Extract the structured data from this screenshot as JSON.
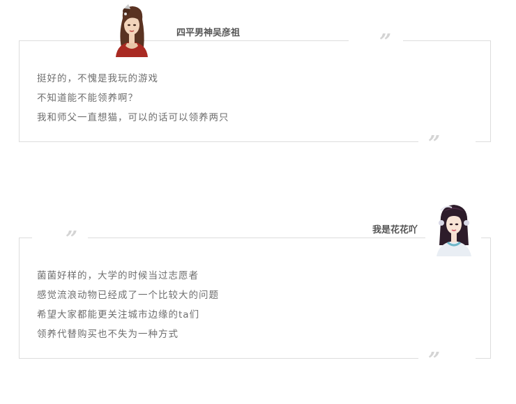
{
  "comments": [
    {
      "username": "四平男神吴彦祖",
      "avatar_icon": "female-character-avatar-icon",
      "lines": [
        "挺好的，不愧是我玩的游戏",
        "不知道能不能领养啊？",
        "我和师父一直想猫，可以的话可以领养两只"
      ]
    },
    {
      "username": "我是花花吖",
      "avatar_icon": "female-character-avatar-icon",
      "lines": [
        "菌菌好样的，大学的时候当过志愿者",
        "感觉流浪动物已经成了一个比较大的问题",
        "希望大家都能更关注城市边缘的ta们",
        "领养代替购买也不失为一种方式"
      ]
    }
  ],
  "quote_mark": "”",
  "colors": {
    "border": "#dcdcdc",
    "quote": "#d4d4d4",
    "text": "#6e6e6e",
    "name": "#555555"
  }
}
